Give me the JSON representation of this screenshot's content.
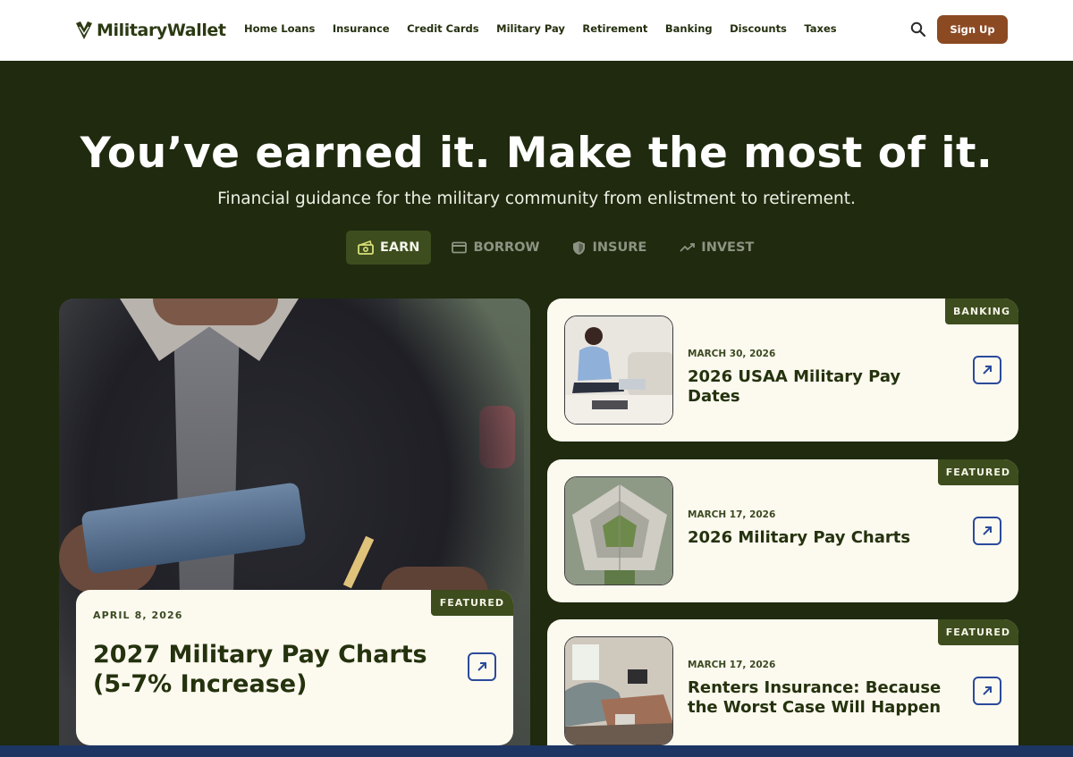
{
  "header": {
    "logo_text": "MilitaryWallet",
    "nav": [
      "Home Loans",
      "Insurance",
      "Credit Cards",
      "Military Pay",
      "Retirement",
      "Banking",
      "Discounts",
      "Taxes"
    ],
    "signup_label": "Sign Up"
  },
  "hero": {
    "headline": "You’ve earned it. Make the most of it.",
    "subhead": "Financial guidance for the military community from enlistment to retirement.",
    "tabs": [
      {
        "label": "EARN",
        "icon": "cash-icon",
        "active": true
      },
      {
        "label": "BORROW",
        "icon": "credit-card-icon",
        "active": false
      },
      {
        "label": "INSURE",
        "icon": "shield-icon",
        "active": false
      },
      {
        "label": "INVEST",
        "icon": "trending-up-icon",
        "active": false
      }
    ]
  },
  "featured": {
    "badge": "FEATURED",
    "date": "APRIL 8, 2026",
    "title": "2027 Military Pay Charts (5-7% Increase)"
  },
  "articles": [
    {
      "badge": "BANKING",
      "date": "MARCH 30, 2026",
      "title": "2026 USAA Military Pay Dates"
    },
    {
      "badge": "FEATURED",
      "date": "MARCH 17, 2026",
      "title": "2026 Military Pay Charts"
    },
    {
      "badge": "FEATURED",
      "date": "MARCH 17, 2026",
      "title": "Renters Insurance: Because the Worst Case Will Happen"
    }
  ],
  "colors": {
    "hero_bg": "#1f2a0e",
    "accent_green": "#3d4d1e",
    "signup_brown": "#8c4a23",
    "card_bg": "#fcf9ef",
    "arrow_blue": "#2b4a9a"
  }
}
